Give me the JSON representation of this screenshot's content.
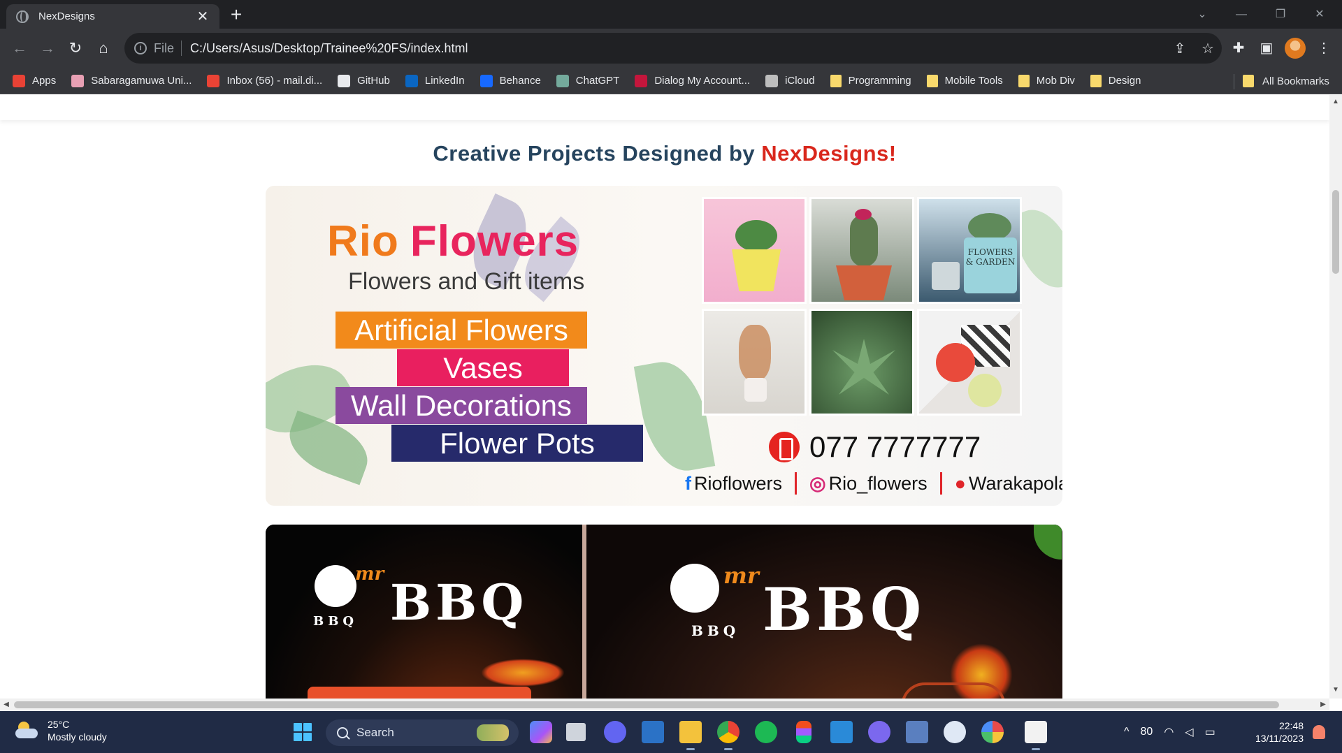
{
  "browser": {
    "tab_title": "NexDesigns",
    "tab_close": "✕",
    "new_tab": "+",
    "window_controls": {
      "dropdown": "⌄",
      "minimize": "—",
      "restore": "❐",
      "close": "✕"
    },
    "nav": {
      "back": "←",
      "forward": "→",
      "reload": "↻",
      "home": "⌂"
    },
    "address": {
      "info_glyph": "i",
      "scheme": "File",
      "url": "C:/Users/Asus/Desktop/Trainee%20FS/index.html",
      "share_glyph": "⇪",
      "star_glyph": "☆"
    },
    "toolbar_icons": {
      "extensions": "✚",
      "sidebar": "▣",
      "menu": "⋮"
    }
  },
  "bookmarks": {
    "items": [
      {
        "label": "Apps",
        "icon": "apps-grid-icon",
        "color": "#e94235"
      },
      {
        "label": "Sabaragamuwa Uni...",
        "icon": "university-icon",
        "color": "#e8a0b4"
      },
      {
        "label": "Inbox (56) - mail.di...",
        "icon": "gmail-icon",
        "color": "#ea4335"
      },
      {
        "label": "GitHub",
        "icon": "github-icon",
        "color": "#e8eaed"
      },
      {
        "label": "LinkedIn",
        "icon": "linkedin-icon",
        "color": "#0a66c2"
      },
      {
        "label": "Behance",
        "icon": "behance-icon",
        "color": "#1769ff"
      },
      {
        "label": "ChatGPT",
        "icon": "chatgpt-icon",
        "color": "#74aa9c"
      },
      {
        "label": "Dialog My Account...",
        "icon": "dialog-icon",
        "color": "#c4163c"
      },
      {
        "label": "iCloud",
        "icon": "apple-icon",
        "color": "#bdbdbd"
      },
      {
        "label": "Programming",
        "icon": "folder-icon",
        "color": "#f8d96c"
      },
      {
        "label": "Mobile Tools",
        "icon": "folder-icon",
        "color": "#f8d96c"
      },
      {
        "label": "Mob Div",
        "icon": "folder-icon",
        "color": "#f8d96c"
      },
      {
        "label": "Design",
        "icon": "folder-icon",
        "color": "#f8d96c"
      }
    ],
    "all_bookmarks": "All Bookmarks"
  },
  "page": {
    "heading_prefix": "Creative Projects Designed by",
    "heading_brand": "NexDesigns!",
    "rio_card": {
      "logo_part1": "Rio",
      "logo_part2": "Flowers",
      "tagline": "Flowers and Gift items",
      "services": [
        {
          "label": "Artificial Flowers",
          "color": "#f28a1b"
        },
        {
          "label": "Vases",
          "color": "#e91f5f"
        },
        {
          "label": "Wall Decorations",
          "color": "#8a4a9e"
        },
        {
          "label": "Flower Pots",
          "color": "#262a6b"
        }
      ],
      "phone": "077 7777777",
      "facebook": "Rioflowers",
      "instagram": "Rio_flowers",
      "location": "Warakapola",
      "pot_label_1": "FLOWERS",
      "pot_label_2": "& GARDEN"
    },
    "bbq_card": {
      "brand_small": "BBQ",
      "brand_word": "BBQ",
      "brand_prefix": "mr"
    }
  },
  "taskbar": {
    "weather_temp": "25°C",
    "weather_desc": "Mostly cloudy",
    "search_placeholder": "Search",
    "tray_caret": "^",
    "tray_value": "80",
    "time": "22:48",
    "date": "13/11/2023"
  },
  "colors": {
    "heading": "#26445e",
    "brand_red": "#d9271c",
    "chrome_dark": "#202124",
    "chrome_toolbar": "#35363a",
    "taskbar": "#202b45"
  }
}
